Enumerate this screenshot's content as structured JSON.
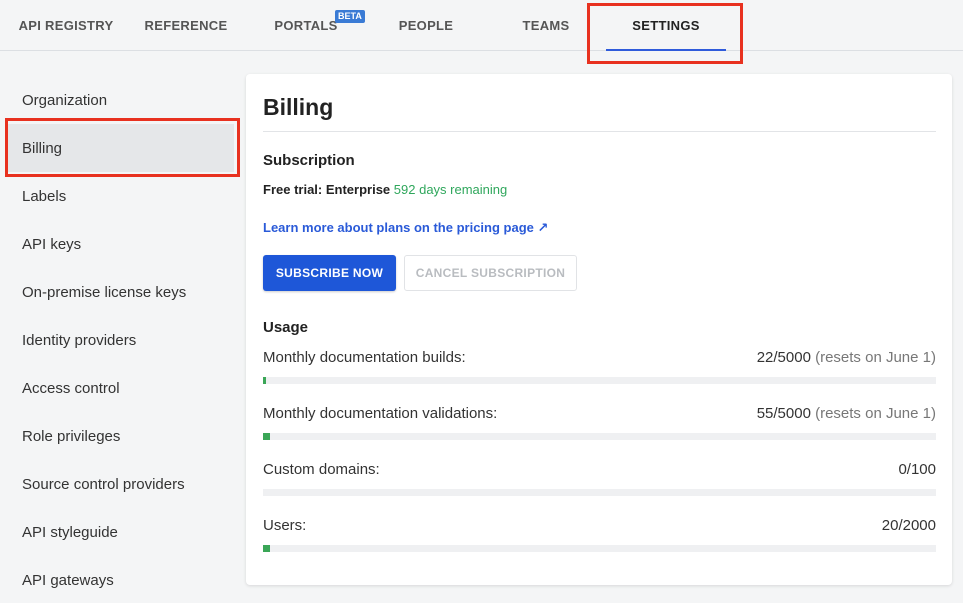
{
  "nav": {
    "tabs": [
      {
        "label": "API REGISTRY"
      },
      {
        "label": "REFERENCE"
      },
      {
        "label": "PORTALS",
        "badge": "BETA"
      },
      {
        "label": "PEOPLE"
      },
      {
        "label": "TEAMS"
      },
      {
        "label": "SETTINGS",
        "active": true
      }
    ]
  },
  "sidebar": {
    "items": [
      {
        "label": "Organization"
      },
      {
        "label": "Billing",
        "active": true
      },
      {
        "label": "Labels"
      },
      {
        "label": "API keys"
      },
      {
        "label": "On-premise license keys"
      },
      {
        "label": "Identity providers"
      },
      {
        "label": "Access control"
      },
      {
        "label": "Role privileges"
      },
      {
        "label": "Source control providers"
      },
      {
        "label": "API styleguide"
      },
      {
        "label": "API gateways"
      }
    ]
  },
  "main": {
    "title": "Billing",
    "subscription": {
      "heading": "Subscription",
      "plan_prefix": "Free trial: Enterprise",
      "remaining": "592 days remaining",
      "pricing_link": "Learn more about plans on the pricing page",
      "pricing_link_icon": "↗",
      "subscribe_button": "SUBSCRIBE NOW",
      "cancel_button": "CANCEL SUBSCRIPTION"
    },
    "usage": {
      "heading": "Usage",
      "items": [
        {
          "label": "Monthly documentation builds:",
          "value": "22/5000",
          "note": "(resets on June 1)",
          "fraction": 0.0044
        },
        {
          "label": "Monthly documentation validations:",
          "value": "55/5000",
          "note": "(resets on June 1)",
          "fraction": 0.011
        },
        {
          "label": "Custom domains:",
          "value": "0/100",
          "note": "",
          "fraction": 0
        },
        {
          "label": "Users:",
          "value": "20/2000",
          "note": "",
          "fraction": 0.01
        }
      ]
    }
  },
  "colors": {
    "accent": "#1e57d8",
    "success": "#3aa657",
    "highlight": "#e8311f"
  }
}
